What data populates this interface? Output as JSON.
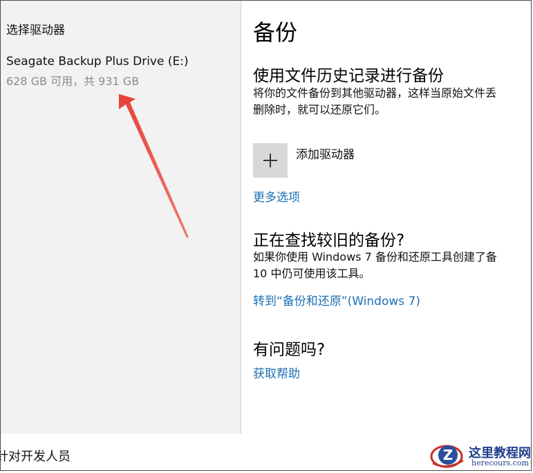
{
  "flyout": {
    "title": "选择驱动器",
    "drive": {
      "name": "Seagate Backup Plus Drive (E:)",
      "space": "628 GB 可用，共 931 GB"
    }
  },
  "main": {
    "title": "备份",
    "file_history": {
      "heading": "使用文件历史记录进行备份",
      "desc_line1": "将你的文件备份到其他驱动器，这样当原始文件丢",
      "desc_line2": "删除时，就可以还原它们。",
      "add_drive_label": "添加驱动器",
      "more_options": "更多选项"
    },
    "older_backup": {
      "heading": "正在查找较旧的备份?",
      "desc_line1": "如果你使用 Windows 7 备份和还原工具创建了备",
      "desc_line2": "10 中仍可使用该工具。",
      "link": "转到“备份和还原”(Windows 7)"
    },
    "help": {
      "heading": "有问题吗?",
      "link": "获取帮助"
    }
  },
  "bottom": {
    "text": "针对开发人员"
  },
  "watermark": {
    "brand": "这里教程网",
    "site": "herecours.com"
  },
  "colors": {
    "accent_link": "#1a6fb5",
    "flyout_bg": "#f2f2f2",
    "annotation_arrow": "#e8413a"
  },
  "icons": [
    "plus-icon",
    "annotation-arrow",
    "watermark-logo-icon"
  ]
}
